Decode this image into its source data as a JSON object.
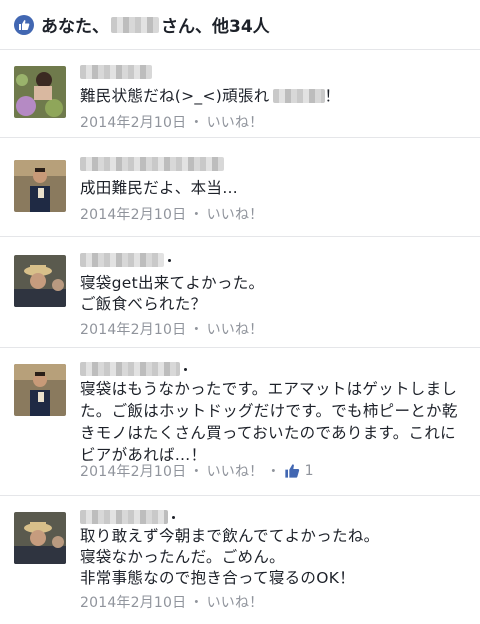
{
  "header": {
    "prefix": "あなた、",
    "suffix": "さん、他34人"
  },
  "comments": [
    {
      "text_before": "難民状態だね(>_<)頑張れ",
      "text_after": "！",
      "timestamp": "2014年2月10日",
      "like_label": "いいね！"
    },
    {
      "text": "成田難民だよ、本当…",
      "timestamp": "2014年2月10日",
      "like_label": "いいね！"
    },
    {
      "text": "寝袋get出来てよかった。\nご飯食べられた？",
      "timestamp": "2014年2月10日",
      "like_label": "いいね！"
    },
    {
      "text": "寝袋はもうなかったです。エアマットはゲットしました。ご飯はホットドッグだけです。でも柿ピーとか乾きモノはたくさん買っておいたのであります。これにビアがあれば…！",
      "timestamp": "2014年2月10日",
      "like_label": "いいね！",
      "like_count": "1"
    },
    {
      "text": "取り敢えず今朝まで飲んでてよかったね。\n寝袋なかったんだ。ごめん。\n非常事態なので抱き合って寝るのOK！",
      "timestamp": "2014年2月10日",
      "like_label": "いいね！"
    }
  ],
  "separator": "・",
  "colors": {
    "accent": "#4267b2",
    "meta": "#90949c",
    "text": "#1d2129"
  }
}
